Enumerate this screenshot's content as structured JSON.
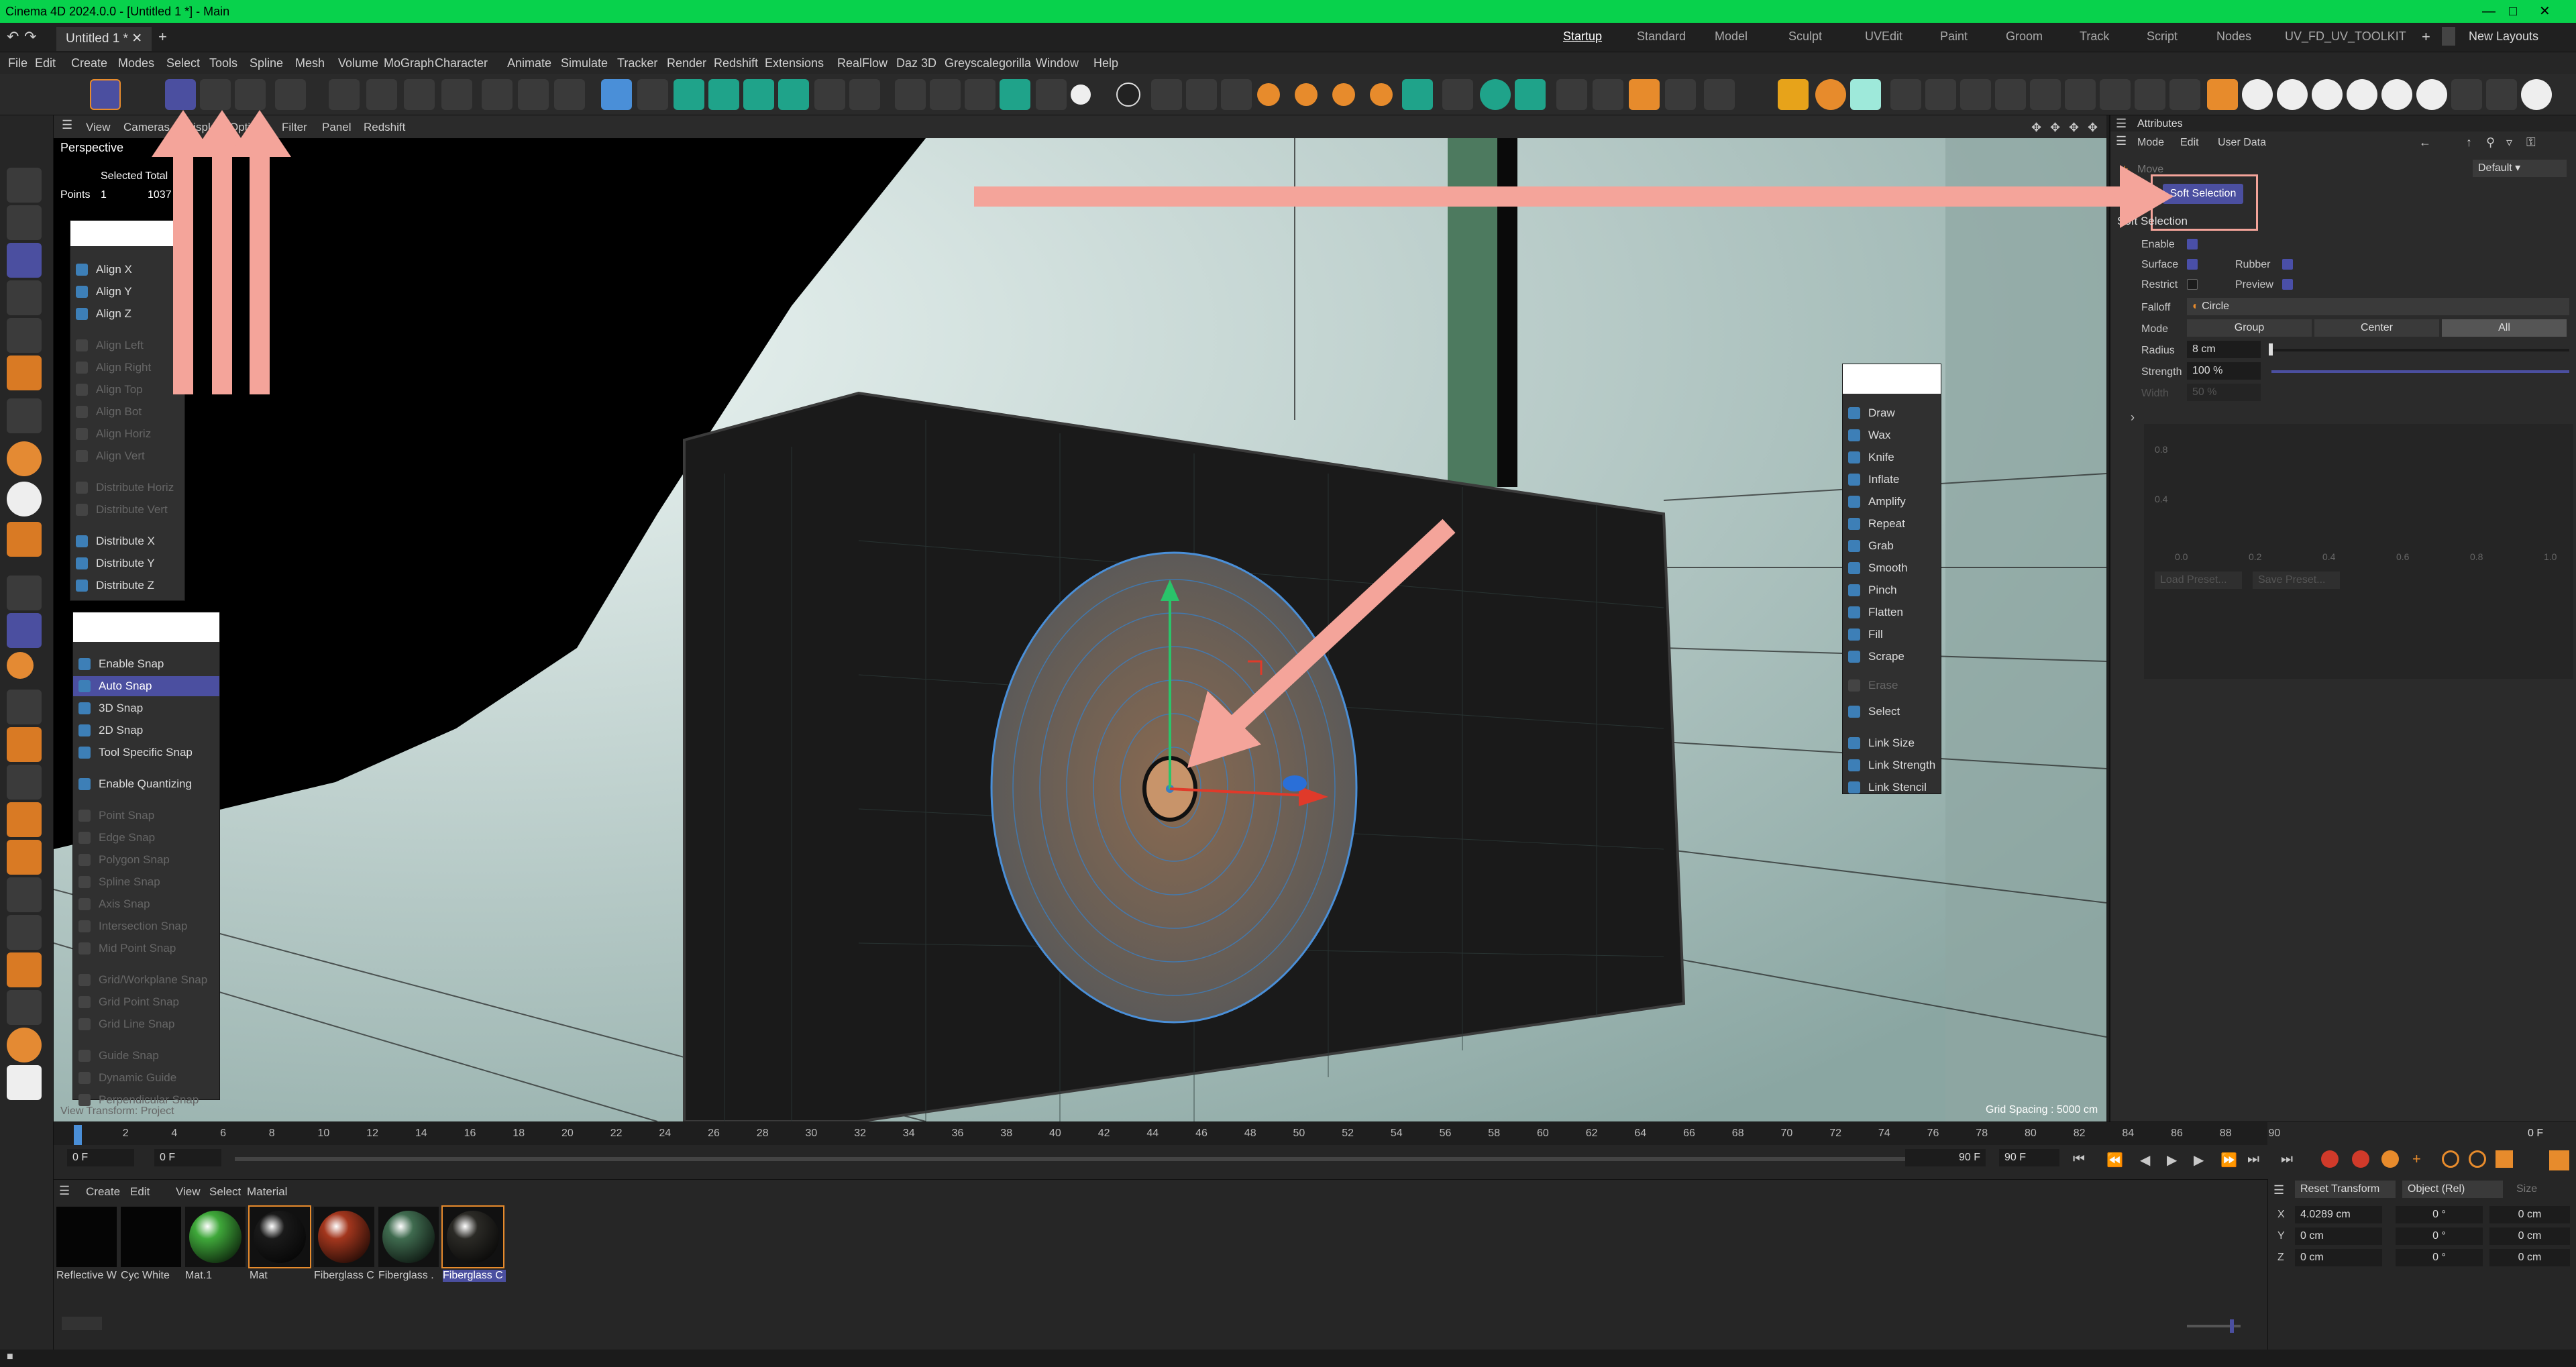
{
  "window": {
    "title": "Cinema 4D 2024.0.0 - [Untitled 1 *] - Main",
    "doc_tab": "Untitled 1 *"
  },
  "layouts": [
    "Startup",
    "Standard",
    "Model",
    "Sculpt",
    "UVEdit",
    "Paint",
    "Groom",
    "Track",
    "Script",
    "Nodes",
    "UV_FD_UV_TOOLKIT"
  ],
  "active_layout": "Startup",
  "new_layouts": "New Layouts",
  "menus": [
    "File",
    "Edit",
    "Create",
    "Modes",
    "Select",
    "Tools",
    "Spline",
    "Mesh",
    "Volume",
    "MoGraph",
    "Character",
    "Animate",
    "Simulate",
    "Tracker",
    "Render",
    "Redshift",
    "Extensions",
    "RealFlow",
    "Daz 3D",
    "Greyscalegorilla",
    "Window",
    "Help"
  ],
  "viewport": {
    "menu": [
      "View",
      "Cameras",
      "Display",
      "Options",
      "Filter",
      "Panel",
      "Redshift"
    ],
    "label": "Perspective",
    "hud": {
      "selected_total": "Selected Total",
      "points_label": "Points",
      "points_selected": "1",
      "points_total": "1037"
    },
    "grid_spacing": "Grid Spacing : 5000 cm",
    "view_transform": "View Transform: Project"
  },
  "align_menu": {
    "items": [
      {
        "label": "Align X",
        "enabled": true
      },
      {
        "label": "Align Y",
        "enabled": true
      },
      {
        "label": "Align Z",
        "enabled": true
      },
      {
        "label": "Align Left",
        "enabled": false
      },
      {
        "label": "Align Right",
        "enabled": false
      },
      {
        "label": "Align Top",
        "enabled": false
      },
      {
        "label": "Align Bot",
        "enabled": false
      },
      {
        "label": "Align Horiz",
        "enabled": false
      },
      {
        "label": "Align Vert",
        "enabled": false
      },
      {
        "label": "Distribute Horiz",
        "enabled": false
      },
      {
        "label": "Distribute Vert",
        "enabled": false
      },
      {
        "label": "Distribute X",
        "enabled": true
      },
      {
        "label": "Distribute Y",
        "enabled": true
      },
      {
        "label": "Distribute Z",
        "enabled": true
      }
    ]
  },
  "snap_menu": {
    "items": [
      {
        "label": "Enable Snap",
        "enabled": true,
        "selected": false
      },
      {
        "label": "Auto Snap",
        "enabled": true,
        "selected": true
      },
      {
        "label": "3D Snap",
        "enabled": true,
        "selected": false
      },
      {
        "label": "2D Snap",
        "enabled": true,
        "selected": false
      },
      {
        "label": "Tool Specific Snap",
        "enabled": true,
        "selected": false
      },
      {
        "label": "Enable Quantizing",
        "enabled": true,
        "selected": false
      },
      {
        "label": "Point Snap",
        "enabled": false,
        "selected": false
      },
      {
        "label": "Edge Snap",
        "enabled": false,
        "selected": false
      },
      {
        "label": "Polygon Snap",
        "enabled": false,
        "selected": false
      },
      {
        "label": "Spline Snap",
        "enabled": false,
        "selected": false
      },
      {
        "label": "Axis Snap",
        "enabled": false,
        "selected": false
      },
      {
        "label": "Intersection Snap",
        "enabled": false,
        "selected": false
      },
      {
        "label": "Mid Point Snap",
        "enabled": false,
        "selected": false
      },
      {
        "label": "Grid/Workplane Snap",
        "enabled": false,
        "selected": false
      },
      {
        "label": "Grid Point Snap",
        "enabled": false,
        "selected": false
      },
      {
        "label": "Grid Line Snap",
        "enabled": false,
        "selected": false
      },
      {
        "label": "Guide Snap",
        "enabled": false,
        "selected": false
      },
      {
        "label": "Dynamic Guide",
        "enabled": false,
        "selected": false
      },
      {
        "label": "Perpendicular Snap",
        "enabled": false,
        "selected": false
      }
    ]
  },
  "sculpt_menu": {
    "items": [
      {
        "label": "Draw",
        "enabled": true
      },
      {
        "label": "Wax",
        "enabled": true
      },
      {
        "label": "Knife",
        "enabled": true
      },
      {
        "label": "Inflate",
        "enabled": true
      },
      {
        "label": "Amplify",
        "enabled": true
      },
      {
        "label": "Repeat",
        "enabled": true
      },
      {
        "label": "Grab",
        "enabled": true
      },
      {
        "label": "Smooth",
        "enabled": true
      },
      {
        "label": "Pinch",
        "enabled": true
      },
      {
        "label": "Flatten",
        "enabled": true
      },
      {
        "label": "Fill",
        "enabled": true
      },
      {
        "label": "Scrape",
        "enabled": true
      },
      {
        "label": "Erase",
        "enabled": false
      },
      {
        "label": "Select",
        "enabled": true
      },
      {
        "label": "Link Size",
        "enabled": true
      },
      {
        "label": "Link Strength",
        "enabled": true
      },
      {
        "label": "Link Stencil",
        "enabled": true
      }
    ]
  },
  "attributes": {
    "title": "Attributes",
    "tabs": [
      "Mode",
      "Edit",
      "User Data"
    ],
    "preset": "Default",
    "tool": "Move",
    "active_tab": "Soft Selection",
    "section": "Soft Selection",
    "enable_label": "Enable",
    "enable": true,
    "surface_label": "Surface",
    "surface": true,
    "rubber_label": "Rubber",
    "rubber": true,
    "restrict_label": "Restrict",
    "restrict": false,
    "preview_label": "Preview",
    "preview": true,
    "falloff_label": "Falloff",
    "falloff": "Circle",
    "mode_label": "Mode",
    "modes": [
      "Group",
      "Center",
      "All"
    ],
    "active_mode": "All",
    "radius_label": "Radius",
    "radius": "8 cm",
    "strength_label": "Strength",
    "strength": "100 %",
    "strength_fraction": 1.0,
    "width_label": "Width",
    "width": "50 %",
    "graph_y": [
      "0.8",
      "0.4"
    ],
    "graph_x": [
      "0.0",
      "0.2",
      "0.4",
      "0.6",
      "0.8",
      "1.0"
    ],
    "load_preset": "Load Preset...",
    "save_preset": "Save Preset..."
  },
  "timeline": {
    "ticks": [
      "0",
      "2",
      "4",
      "6",
      "8",
      "10",
      "12",
      "14",
      "16",
      "18",
      "20",
      "22",
      "24",
      "26",
      "28",
      "30",
      "32",
      "34",
      "36",
      "38",
      "40",
      "42",
      "44",
      "46",
      "48",
      "50",
      "52",
      "54",
      "56",
      "58",
      "60",
      "62",
      "64",
      "66",
      "68",
      "70",
      "72",
      "74",
      "76",
      "78",
      "80",
      "82",
      "84",
      "86",
      "88",
      "90"
    ],
    "current_frame": "0 F",
    "start": "0 F",
    "preview_start": "0 F",
    "end": "90 F",
    "preview_end": "90 F"
  },
  "materials": {
    "menu": [
      "Create",
      "Edit",
      "View",
      "Select",
      "Material"
    ],
    "items": [
      {
        "label": "Reflective W",
        "color": "#050505"
      },
      {
        "label": "Cyc White",
        "color": "#050505"
      },
      {
        "label": "Mat.1",
        "color": "#3fa83a"
      },
      {
        "label": "Mat",
        "color": "#1a1a1a"
      },
      {
        "label": "Fiberglass C",
        "color": "#a3361d"
      },
      {
        "label": "Fiberglass .",
        "color": "#3f6b4f"
      },
      {
        "label": "Fiberglass C",
        "color": "#2b2a26"
      }
    ]
  },
  "coordinates": {
    "reset": "Reset Transform",
    "space": "Object (Rel)",
    "size_label": "Size",
    "rows": [
      {
        "axis": "X",
        "pos": "4.0289 cm",
        "rot": "0 °",
        "size": "0 cm"
      },
      {
        "axis": "Y",
        "pos": "0 cm",
        "rot": "0 °",
        "size": "0 cm"
      },
      {
        "axis": "Z",
        "pos": "0 cm",
        "rot": "0 °",
        "size": "0 cm"
      }
    ]
  },
  "colors": {
    "accent": "#4b4fa0",
    "title_green": "#08d24c",
    "arrow": "#f4a49a",
    "orange": "#e78b2c"
  }
}
